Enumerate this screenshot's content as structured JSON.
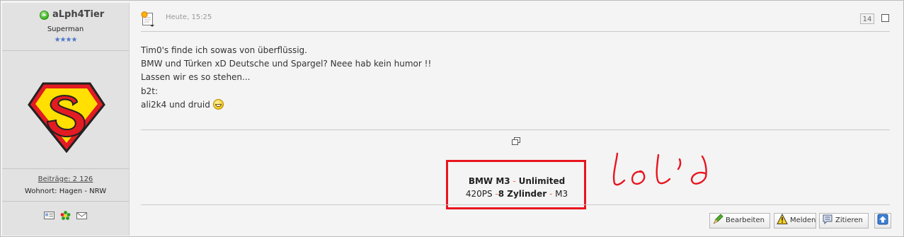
{
  "user": {
    "name": "aLph4Tier",
    "rank": "Superman",
    "stars": "★★★★",
    "posts_label": "Beiträge: 2 126",
    "location_label": "Wohnort: Hagen - NRW"
  },
  "post": {
    "date": "Heute, 15:25",
    "number": "14",
    "message_lines": [
      "Tim0's finde ich sowas von überflüssig.",
      "BMW und Türken xD Deutsche und Spargel? Neee hab kein humor !!",
      "Lassen wir es so stehen...",
      "b2t:",
      "",
      "ali2k4 und druid"
    ]
  },
  "signature": {
    "line1_a": "BMW M3",
    "line1_sep": " - ",
    "line1_b": "Unlimited",
    "line2_a": "420PS",
    "line2_sep1": " -",
    "line2_b": "8 Zylinder",
    "line2_sep2": " - ",
    "line2_c": "M3"
  },
  "buttons": {
    "edit": "Bearbeiten",
    "report": "Melden",
    "quote": "Zitieren"
  },
  "colors": {
    "highlight_box": "#e8151e",
    "signature_separator": "#ff6a3d",
    "sidebar_bg": "#e2e2e2",
    "post_bg": "#f4f4f4"
  }
}
